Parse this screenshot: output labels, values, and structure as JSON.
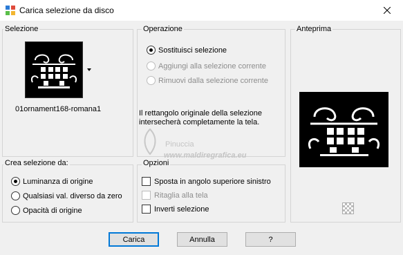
{
  "window": {
    "title": "Carica selezione da disco"
  },
  "selection": {
    "group_title": "Selezione",
    "file_name": "01ornament168-romana1"
  },
  "operation": {
    "group_title": "Operazione",
    "options": [
      {
        "label": "Sostituisci selezione",
        "checked": true,
        "enabled": true
      },
      {
        "label": "Aggiungi alla selezione corrente",
        "checked": false,
        "enabled": false
      },
      {
        "label": "Rimuovi dalla selezione corrente",
        "checked": false,
        "enabled": false
      }
    ],
    "info_text": "Il rettangolo originale della selezione intersecherà completamente la tela."
  },
  "preview": {
    "group_title": "Anteprima"
  },
  "create_from": {
    "group_title": "Crea selezione da:",
    "options": [
      {
        "label": "Luminanza di origine",
        "checked": true
      },
      {
        "label": "Qualsiasi val. diverso da zero",
        "checked": false
      },
      {
        "label": "Opacità di origine",
        "checked": false
      }
    ]
  },
  "options": {
    "group_title": "Opzioni",
    "items": [
      {
        "label": "Sposta in angolo superiore sinistro",
        "checked": false,
        "enabled": true
      },
      {
        "label": "Ritaglia alla tela",
        "checked": false,
        "enabled": false
      },
      {
        "label": "Inverti selezione",
        "checked": false,
        "enabled": true
      }
    ]
  },
  "watermark": {
    "line1": "Pinuccia",
    "line2": "www.maldiregrafica.eu"
  },
  "buttons": {
    "ok": "Carica",
    "cancel": "Annulla",
    "help": "?"
  }
}
